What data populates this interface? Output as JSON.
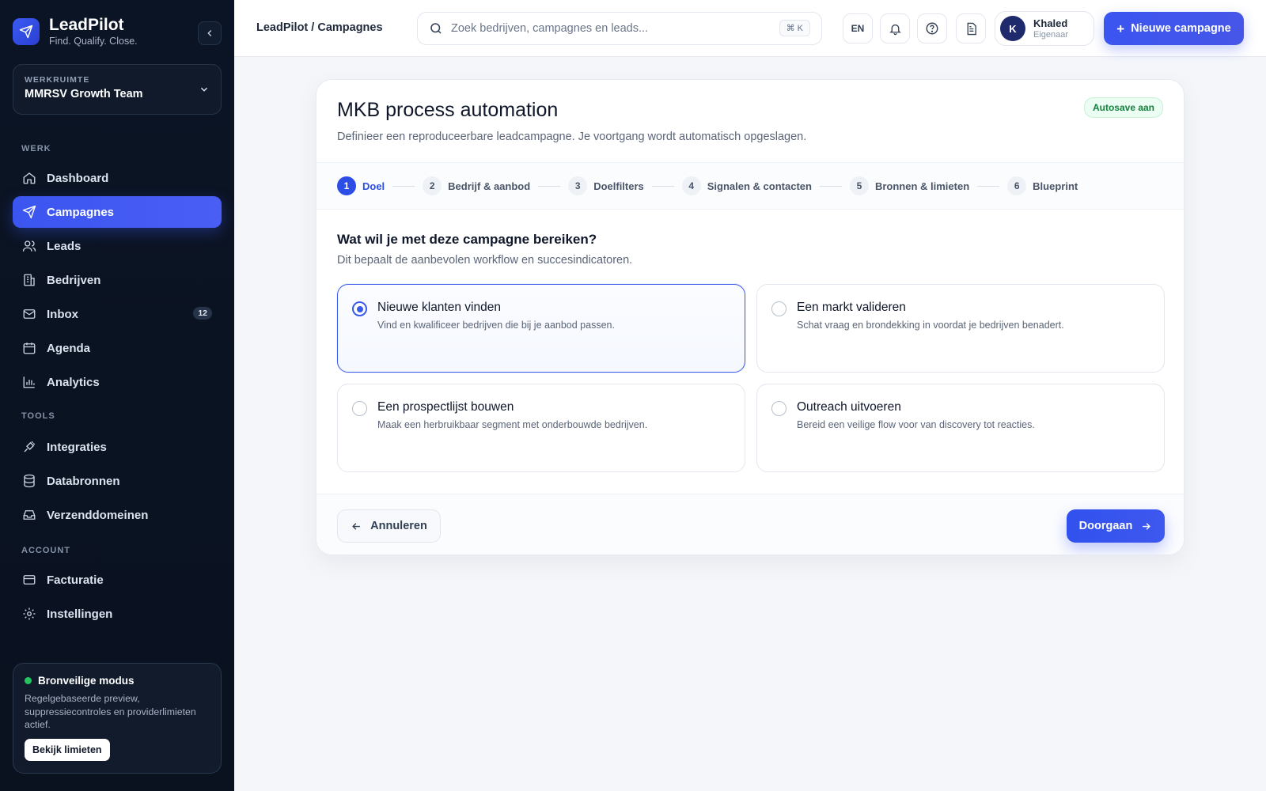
{
  "brand": {
    "name": "LeadPilot",
    "tagline": "Find. Qualify. Close."
  },
  "workspace": {
    "label": "WERKRUIMTE",
    "name": "MMRSV Growth Team"
  },
  "sidebar": {
    "sections": {
      "work": "WERK",
      "tools": "TOOLS",
      "account": "ACCOUNT"
    },
    "items": [
      {
        "label": "Dashboard",
        "icon": "home-icon"
      },
      {
        "label": "Campagnes",
        "icon": "send-icon",
        "active": true
      },
      {
        "label": "Leads",
        "icon": "users-icon"
      },
      {
        "label": "Bedrijven",
        "icon": "building-icon"
      },
      {
        "label": "Inbox",
        "icon": "mail-icon",
        "badge": "12"
      },
      {
        "label": "Agenda",
        "icon": "calendar-icon"
      },
      {
        "label": "Analytics",
        "icon": "bar-chart-icon"
      },
      {
        "label": "Integraties",
        "icon": "plug-icon"
      },
      {
        "label": "Databronnen",
        "icon": "database-icon"
      },
      {
        "label": "Verzenddomeinen",
        "icon": "inbox-icon"
      },
      {
        "label": "Facturatie",
        "icon": "credit-card-icon"
      },
      {
        "label": "Instellingen",
        "icon": "gear-icon"
      }
    ],
    "safe_mode": {
      "title": "Bronveilige modus",
      "description": "Regelgebaseerde preview, suppressiecontroles en providerlimieten actief.",
      "button": "Bekijk limieten"
    }
  },
  "topbar": {
    "breadcrumb": "LeadPilot / Campagnes",
    "search_placeholder": "Zoek bedrijven, campagnes en leads...",
    "search_shortcut": "⌘ K",
    "language": "EN",
    "user": {
      "initial": "K",
      "name": "Khaled",
      "role": "Eigenaar"
    },
    "new_campaign": "Nieuwe campagne"
  },
  "card": {
    "title": "MKB process automation",
    "subtitle": "Definieer een reproduceerbare leadcampagne. Je voortgang wordt automatisch opgeslagen.",
    "autosave": "Autosave aan",
    "steps": [
      {
        "num": "1",
        "label": "Doel",
        "active": true
      },
      {
        "num": "2",
        "label": "Bedrijf & aanbod"
      },
      {
        "num": "3",
        "label": "Doelfilters"
      },
      {
        "num": "4",
        "label": "Signalen & contacten"
      },
      {
        "num": "5",
        "label": "Bronnen & limieten"
      },
      {
        "num": "6",
        "label": "Blueprint"
      }
    ],
    "question": "Wat wil je met deze campagne bereiken?",
    "question_sub": "Dit bepaalt de aanbevolen workflow en succesindicatoren.",
    "options": [
      {
        "title": "Nieuwe klanten vinden",
        "desc": "Vind en kwalificeer bedrijven die bij je aanbod passen.",
        "selected": true
      },
      {
        "title": "Een markt valideren",
        "desc": "Schat vraag en brondekking in voordat je bedrijven benadert."
      },
      {
        "title": "Een prospectlijst bouwen",
        "desc": "Maak een herbruikbaar segment met onderbouwde bedrijven."
      },
      {
        "title": "Outreach uitvoeren",
        "desc": "Bereid een veilige flow voor van discovery tot reacties."
      }
    ],
    "cancel": "Annuleren",
    "continue": "Doorgaan"
  },
  "colors": {
    "accent": "#3b55f0",
    "sidebar_bg": "#0b1424",
    "success": "#22c55e"
  }
}
